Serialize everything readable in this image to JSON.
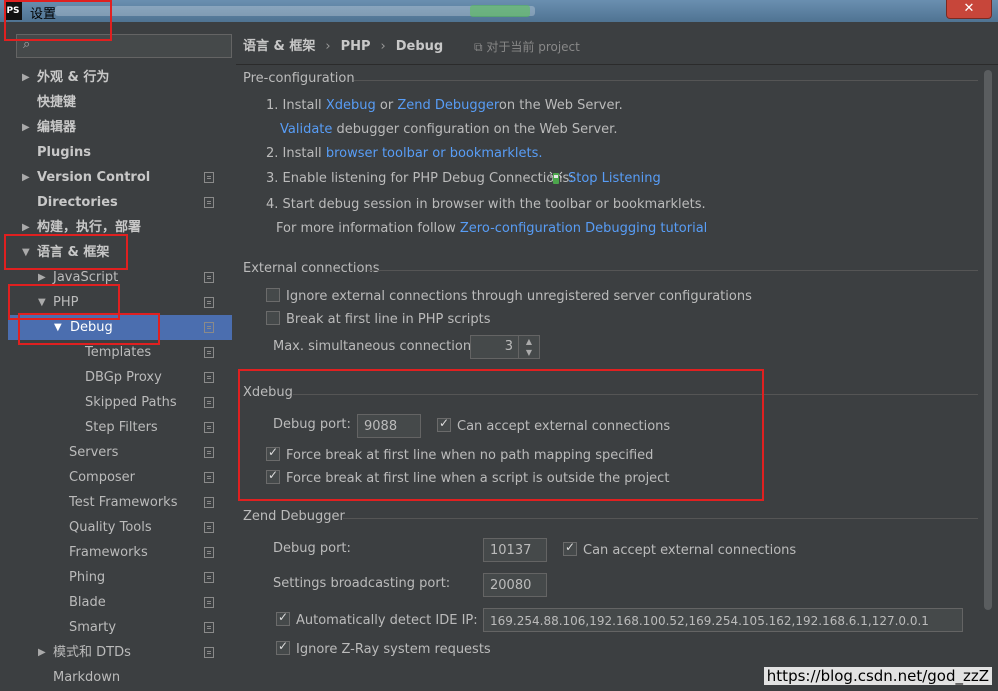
{
  "window": {
    "title": "设置",
    "app_icon": "PS",
    "close": "✕"
  },
  "sidebar": {
    "search_placeholder": "",
    "items": [
      {
        "label": "外观 & 行为",
        "arrow": "▶"
      },
      {
        "label": "快捷键"
      },
      {
        "label": "编辑器",
        "arrow": "▶"
      },
      {
        "label": "Plugins"
      },
      {
        "label": "Version Control",
        "arrow": "▶"
      },
      {
        "label": "Directories"
      },
      {
        "label": "构建，执行，部署",
        "arrow": "▶"
      },
      {
        "label": "语言 & 框架",
        "arrow": "▼"
      },
      {
        "label": "JavaScript",
        "arrow": "▶"
      },
      {
        "label": "PHP",
        "arrow": "▼"
      },
      {
        "label": "Debug",
        "arrow": "▼"
      },
      {
        "label": "Templates"
      },
      {
        "label": "DBGp Proxy"
      },
      {
        "label": "Skipped Paths"
      },
      {
        "label": "Step Filters"
      },
      {
        "label": "Servers"
      },
      {
        "label": "Composer"
      },
      {
        "label": "Test Frameworks"
      },
      {
        "label": "Quality Tools"
      },
      {
        "label": "Frameworks"
      },
      {
        "label": "Phing"
      },
      {
        "label": "Blade"
      },
      {
        "label": "Smarty"
      },
      {
        "label": "模式和 DTDs",
        "arrow": "▶"
      },
      {
        "label": "Markdown"
      }
    ]
  },
  "breadcrumb": {
    "a": "语言 & 框架",
    "sep": "›",
    "b": "PHP",
    "c": "Debug",
    "project_hint": "对于当前 project"
  },
  "pre": {
    "title": "Pre-configuration",
    "s1_a": "1. Install",
    "s1_xdebug": "Xdebug",
    "s1_or": "or",
    "s1_zend": "Zend Debugger",
    "s1_b": "on the Web Server.",
    "s1b_validate": "Validate",
    "s1b_rest": "debugger configuration on the Web Server.",
    "s2_a": "2. Install",
    "s2_link": "browser toolbar or bookmarklets.",
    "s3_a": "3. Enable listening for PHP Debug Connections:",
    "s3_link": "Stop Listening",
    "s4": "4. Start debug session in browser with the toolbar or bookmarklets.",
    "s5_a": "For more information follow",
    "s5_link": "Zero-configuration Debugging tutorial"
  },
  "external": {
    "title": "External connections",
    "ignore": "Ignore external connections through unregistered server configurations",
    "break_first": "Break at first line in PHP scripts",
    "max_label": "Max. simultaneous connections:",
    "max_value": "3"
  },
  "xdebug": {
    "title": "Xdebug",
    "port_label": "Debug port:",
    "port": "9088",
    "accept": "Can accept external connections",
    "force1": "Force break at first line when no path mapping specified",
    "force2": "Force break at first line when a script is outside the project"
  },
  "zend": {
    "title": "Zend Debugger",
    "port_label": "Debug port:",
    "port": "10137",
    "accept": "Can accept external connections",
    "bcast_label": "Settings broadcasting port:",
    "bcast": "20080",
    "auto_ip": "Automatically detect IDE IP:",
    "ips": "169.254.88.106,192.168.100.52,169.254.105.162,192.168.6.1,127.0.0.1",
    "ignore_zray": "Ignore Z-Ray system requests"
  },
  "watermark": "https://blog.csdn.net/god_zzZ",
  "colors": {
    "link": "#589df6",
    "selection": "#4b6eaf",
    "highlight": "#e02020"
  }
}
